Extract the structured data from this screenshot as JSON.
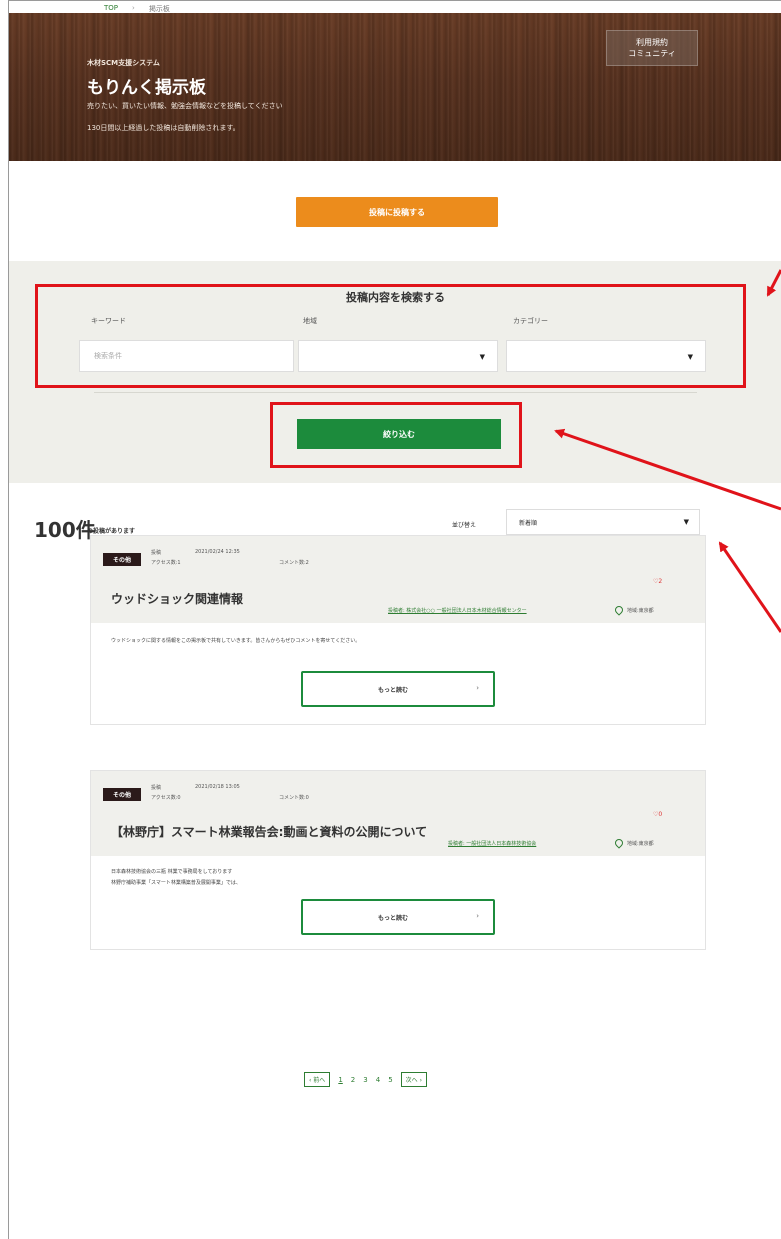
{
  "breadcrumb": {
    "home": "TOP",
    "sep": "›",
    "current": "掲示板"
  },
  "hero": {
    "system_name": "木材SCM支援システム",
    "title": "もりんく掲示板",
    "desc_line1": "売りたい、買いたい情報、勉強会情報などを投稿してください",
    "desc_line2": "130日間以上経過した投稿は自動削除されます。",
    "terms_button": "利用規約\nコミュニティ"
  },
  "post_button": "投稿に投稿する",
  "search": {
    "heading": "投稿内容を検索する",
    "keyword_label": "キーワード",
    "keyword_placeholder": "検索条件",
    "region_label": "地域",
    "category_label": "カテゴリー",
    "filter_button": "絞り込む"
  },
  "results": {
    "count": "100件",
    "suffix": "の投稿があります",
    "sort_label": "並び替え",
    "sort_value": "新着順"
  },
  "posts": [
    {
      "category": "その他",
      "posted_label": "投稿",
      "posted_at": "2021/02/24 12:35",
      "access": "アクセス数:1",
      "comments": "コメント数:2",
      "favorites": "2",
      "title": "ウッドショック関連情報",
      "author": "投稿者: 株式会社○○ 一般社団法人日本木材総合情報センター",
      "region": "地域:東京都",
      "body": "ウッドショックに関する情報をこの掲示板で共有していきます。皆さんからもぜひコメントを寄せてください。",
      "more": "もっと読む",
      "arrow": "›"
    },
    {
      "category": "その他",
      "posted_label": "投稿",
      "posted_at": "2021/02/18 13:05",
      "access": "アクセス数:0",
      "comments": "コメント数:0",
      "favorites": "0",
      "title": "【林野庁】スマート林業報告会:動画と資料の公開について",
      "author": "投稿者: 一般社団法人日本森林技術協会",
      "region": "地域:東京都",
      "body_line1": "日本森林技術協会の三瓶 林業で事務局をしております",
      "body_line2": "林野庁補助事業「スマート林業構築普及展開事業」では、",
      "more": "もっと読む",
      "arrow": "›"
    }
  ],
  "pagination": {
    "prev": "‹ 前へ",
    "pages": [
      "1",
      "2",
      "3",
      "4",
      "5"
    ],
    "next": "次へ ›"
  },
  "colors": {
    "orange": "#ec8c1c",
    "green": "#1c8b3c",
    "annotation_red": "#e0131a",
    "hero_brown": "#5a3320"
  }
}
